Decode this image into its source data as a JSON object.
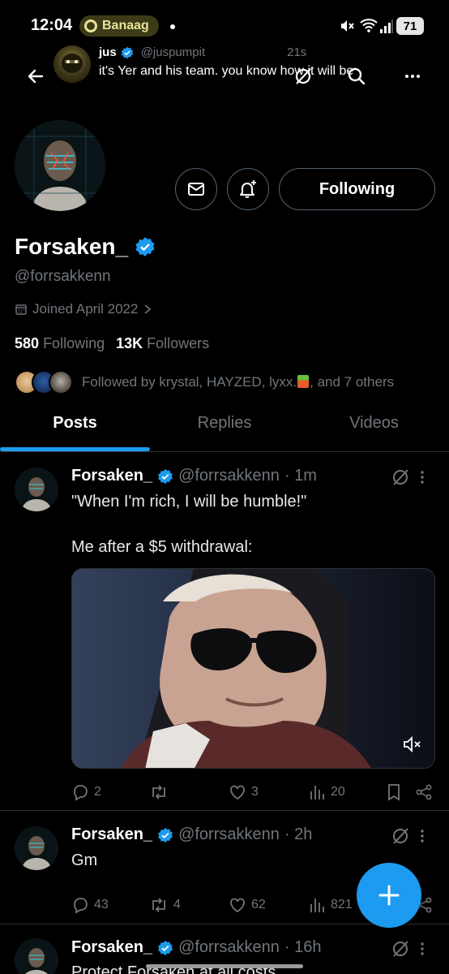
{
  "status_bar": {
    "time": "12:04",
    "carrier_label": "Banaag",
    "battery": "71"
  },
  "header": {
    "banner_tweet": {
      "name": "jus",
      "handle": "@juspumpit",
      "age": "21s",
      "text": "it's Yer and his team. you know how it will be"
    }
  },
  "profile": {
    "display_name": "Forsaken_",
    "handle": "@forrsakkenn",
    "joined": "Joined April 2022",
    "following_count": "580",
    "following_label": "Following",
    "followers_count": "13K",
    "followers_label": "Followers",
    "followed_by": "Followed by krystal, HAYZED, lyxx.",
    "followed_by_tail": ", and 7 others",
    "follow_button": "Following"
  },
  "tabs": [
    "Posts",
    "Replies",
    "Videos"
  ],
  "tweets": [
    {
      "name": "Forsaken_",
      "handle": "@forrsakkenn",
      "age": "· 1m",
      "line1": "\"When I'm rich, I will be humble!\"",
      "line2": "Me after a $5 withdrawal:",
      "replies": "2",
      "retweets": "",
      "likes": "3",
      "views": "20"
    },
    {
      "name": "Forsaken_",
      "handle": "@forrsakkenn",
      "age": "· 2h",
      "line1": "Gm",
      "replies": "43",
      "retweets": "4",
      "likes": "62",
      "views": "821"
    },
    {
      "name": "Forsaken_",
      "handle": "@forrsakkenn",
      "age": "· 16h",
      "line1": "Protect Forsaken at all costs"
    }
  ],
  "colors": {
    "accent": "#1d9bf0",
    "background": "#000000",
    "muted": "#71767b"
  }
}
